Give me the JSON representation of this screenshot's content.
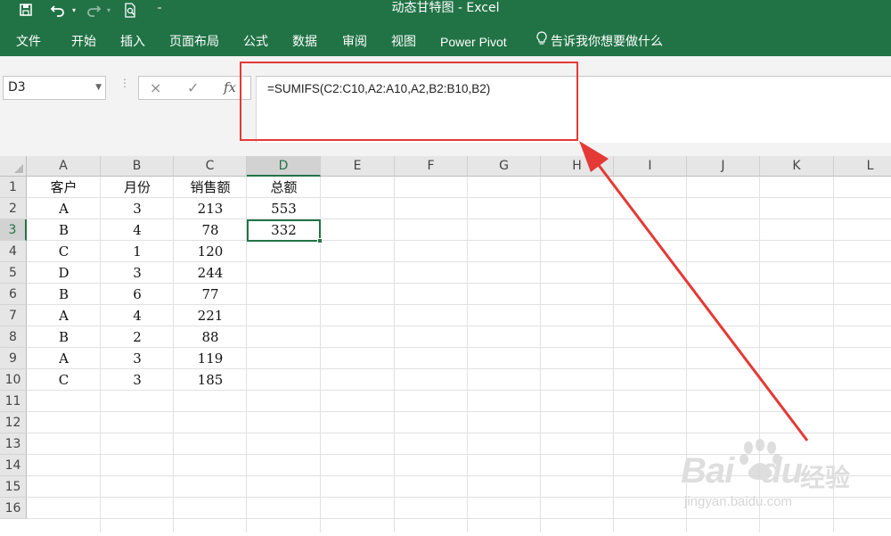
{
  "window": {
    "title": "动态甘特图  -  Excel"
  },
  "quick_access": {
    "save_icon": "save-icon",
    "undo_icon": "undo-icon",
    "redo_icon": "redo-icon",
    "print_preview_icon": "print-preview-icon",
    "customize_icon": "customize-qat-icon"
  },
  "ribbon": {
    "tabs": [
      "文件",
      "开始",
      "插入",
      "页面布局",
      "公式",
      "数据",
      "审阅",
      "视图",
      "Power Pivot"
    ],
    "tell_me": "告诉我你想要做什么",
    "tell_me_icon": "lightbulb-icon"
  },
  "formula_bar": {
    "name_box": "D3",
    "cancel_icon": "×",
    "enter_icon": "✓",
    "fx_label": "fx",
    "formula": "=SUMIFS(C2:C10,A2:A10,A2,B2:B10,B2)"
  },
  "sheet": {
    "columns": [
      "A",
      "B",
      "C",
      "D",
      "E",
      "F",
      "G",
      "H",
      "I",
      "J",
      "K",
      "L"
    ],
    "rows": [
      "1",
      "2",
      "3",
      "4",
      "5",
      "6",
      "7",
      "8",
      "9",
      "10",
      "11",
      "12",
      "13",
      "14",
      "15",
      "16"
    ],
    "selected_cell": "D3",
    "cells": [
      [
        "客户",
        "月份",
        "销售额",
        "总额"
      ],
      [
        "A",
        "3",
        "213",
        "553"
      ],
      [
        "B",
        "4",
        "78",
        "332"
      ],
      [
        "C",
        "1",
        "120",
        ""
      ],
      [
        "D",
        "3",
        "244",
        ""
      ],
      [
        "B",
        "6",
        "77",
        ""
      ],
      [
        "A",
        "4",
        "221",
        ""
      ],
      [
        "B",
        "2",
        "88",
        ""
      ],
      [
        "A",
        "3",
        "119",
        ""
      ],
      [
        "C",
        "3",
        "185",
        ""
      ]
    ]
  },
  "annotation": {
    "highlight_color": "#e53935"
  },
  "watermark": {
    "brand": "Bai",
    "brand2": "du",
    "brand_cn": "经验",
    "url": "jingyan.baidu.com"
  },
  "theme": {
    "accent": "#217346"
  }
}
